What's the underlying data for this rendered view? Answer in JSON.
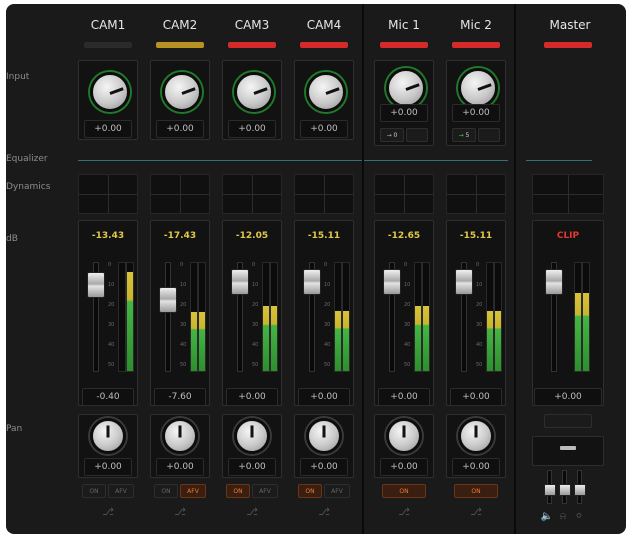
{
  "rows": {
    "input": "Input",
    "equalizer": "Equalizer",
    "dynamics": "Dynamics",
    "db": "dB",
    "pan": "Pan"
  },
  "channels": [
    {
      "name": "CAM1",
      "tally": "#2b2b2b",
      "gain": "+0.00",
      "peak": "-13.43",
      "fader": "-0.40",
      "fader_level": 0.8,
      "meter": 0.0,
      "meter2": 0.92,
      "pan": "+0.00",
      "on": "ON",
      "afv": "AFV",
      "on_active": false,
      "afv_active": false
    },
    {
      "name": "CAM2",
      "tally": "#b89220",
      "gain": "+0.00",
      "peak": "-17.43",
      "fader": "-7.60",
      "fader_level": 0.66,
      "meter": 0.55,
      "meter2": 0.55,
      "pan": "+0.00",
      "on": "ON",
      "afv": "AFV",
      "on_active": false,
      "afv_active": true
    },
    {
      "name": "CAM3",
      "tally": "#d62a2a",
      "gain": "+0.00",
      "peak": "-12.05",
      "fader": "+0.00",
      "fader_level": 0.82,
      "meter": 0.6,
      "meter2": 0.6,
      "pan": "+0.00",
      "on": "ON",
      "afv": "AFV",
      "on_active": true,
      "afv_active": false
    },
    {
      "name": "CAM4",
      "tally": "#d62a2a",
      "gain": "+0.00",
      "peak": "-15.11",
      "fader": "+0.00",
      "fader_level": 0.82,
      "meter": 0.56,
      "meter2": 0.56,
      "pan": "+0.00",
      "on": "ON",
      "afv": "AFV",
      "on_active": true,
      "afv_active": false
    },
    {
      "name": "Mic 1",
      "tally": "#d62a2a",
      "gain": "+0.00",
      "peak": "-12.65",
      "fader": "+0.00",
      "fader_level": 0.82,
      "meter": 0.6,
      "meter2": 0.6,
      "pan": "+0.00",
      "on": "ON",
      "delay": "0",
      "on_active": true
    },
    {
      "name": "Mic 2",
      "tally": "#d62a2a",
      "gain": "+0.00",
      "peak": "-15.11",
      "fader": "+0.00",
      "fader_level": 0.82,
      "meter": 0.56,
      "meter2": 0.56,
      "pan": "+0.00",
      "on": "ON",
      "delay": "5",
      "on_active": true
    }
  ],
  "master": {
    "name": "Master",
    "tally": "#d62a2a",
    "peak": "CLIP",
    "fader": "+0.00",
    "fader_level": 0.82,
    "meter": 0.72,
    "meter2": 0.72
  },
  "colors": {
    "accent_green": "#1f7a2a",
    "tally_red": "#d62a2a",
    "tally_yellow": "#b89220",
    "peak_yellow": "#e0c84a",
    "peak_red": "#e03a2a",
    "on_orange": "#f07a3a"
  },
  "icons": {
    "headphones": "headphones-icon",
    "speaker": "speaker-icon",
    "mic": "mic-icon",
    "arrow": "arrow-right-icon"
  }
}
